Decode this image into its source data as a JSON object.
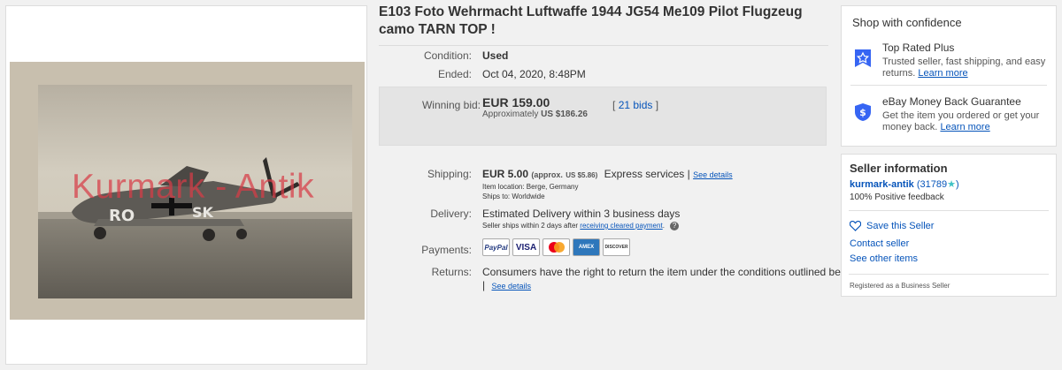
{
  "listing": {
    "title": "E103 Foto Wehrmacht Luftwaffe 1944 JG54 Me109 Pilot Flugzeug camo TARN TOP !",
    "watermark": "Kurmark - Antik",
    "condition_label": "Condition:",
    "condition_value": "Used",
    "ended_label": "Ended:",
    "ended_value": "Oct 04, 2020, 8:48PM",
    "bid_label": "Winning bid:",
    "bid_value": "EUR 159.00",
    "bid_approx_prefix": "Approximately",
    "bid_approx_value": "US $186.26",
    "bids_open": "[",
    "bids_link": "21 bids",
    "bids_close": "]",
    "shipping_label": "Shipping:",
    "shipping_value": "EUR 5.00",
    "shipping_approx": "(approx.",
    "shipping_approx_value": "US $5.86)",
    "shipping_service": "Express services |",
    "shipping_details_link": "See details",
    "item_location": "Item location: Berge, Germany",
    "ships_to": "Ships to: Worldwide",
    "delivery_label": "Delivery:",
    "delivery_value": "Estimated Delivery within 3 business days",
    "delivery_note": "Seller ships within 2 days after",
    "delivery_note_link": "receiving cleared payment",
    "delivery_note_end": ".",
    "payments_label": "Payments:",
    "payment_methods": [
      "PayPal",
      "VISA",
      "mastercard",
      "AMEX",
      "DISCOVER"
    ],
    "returns_label": "Returns:",
    "returns_value": "Consumers have the right to return the item under the conditions outlined below",
    "returns_sep": "|",
    "returns_link": "See details"
  },
  "confidence": {
    "heading": "Shop with confidence",
    "top_rated_title": "Top Rated Plus",
    "top_rated_desc": "Trusted seller, fast shipping, and easy returns.",
    "top_rated_link": "Learn more",
    "mbg_title": "eBay Money Back Guarantee",
    "mbg_desc": "Get the item you ordered or get your money back.",
    "mbg_link": "Learn more"
  },
  "seller": {
    "heading": "Seller information",
    "name": "kurmark-antik",
    "score": "(31789",
    "score_close": ")",
    "feedback": "100% Positive feedback",
    "save_label": "Save this Seller",
    "contact_label": "Contact seller",
    "other_items_label": "See other items",
    "business": "Registered as a Business Seller"
  },
  "colors": {
    "link": "#0654ba",
    "trust_icon": "#3665f3",
    "star": "#3fc2c6"
  }
}
